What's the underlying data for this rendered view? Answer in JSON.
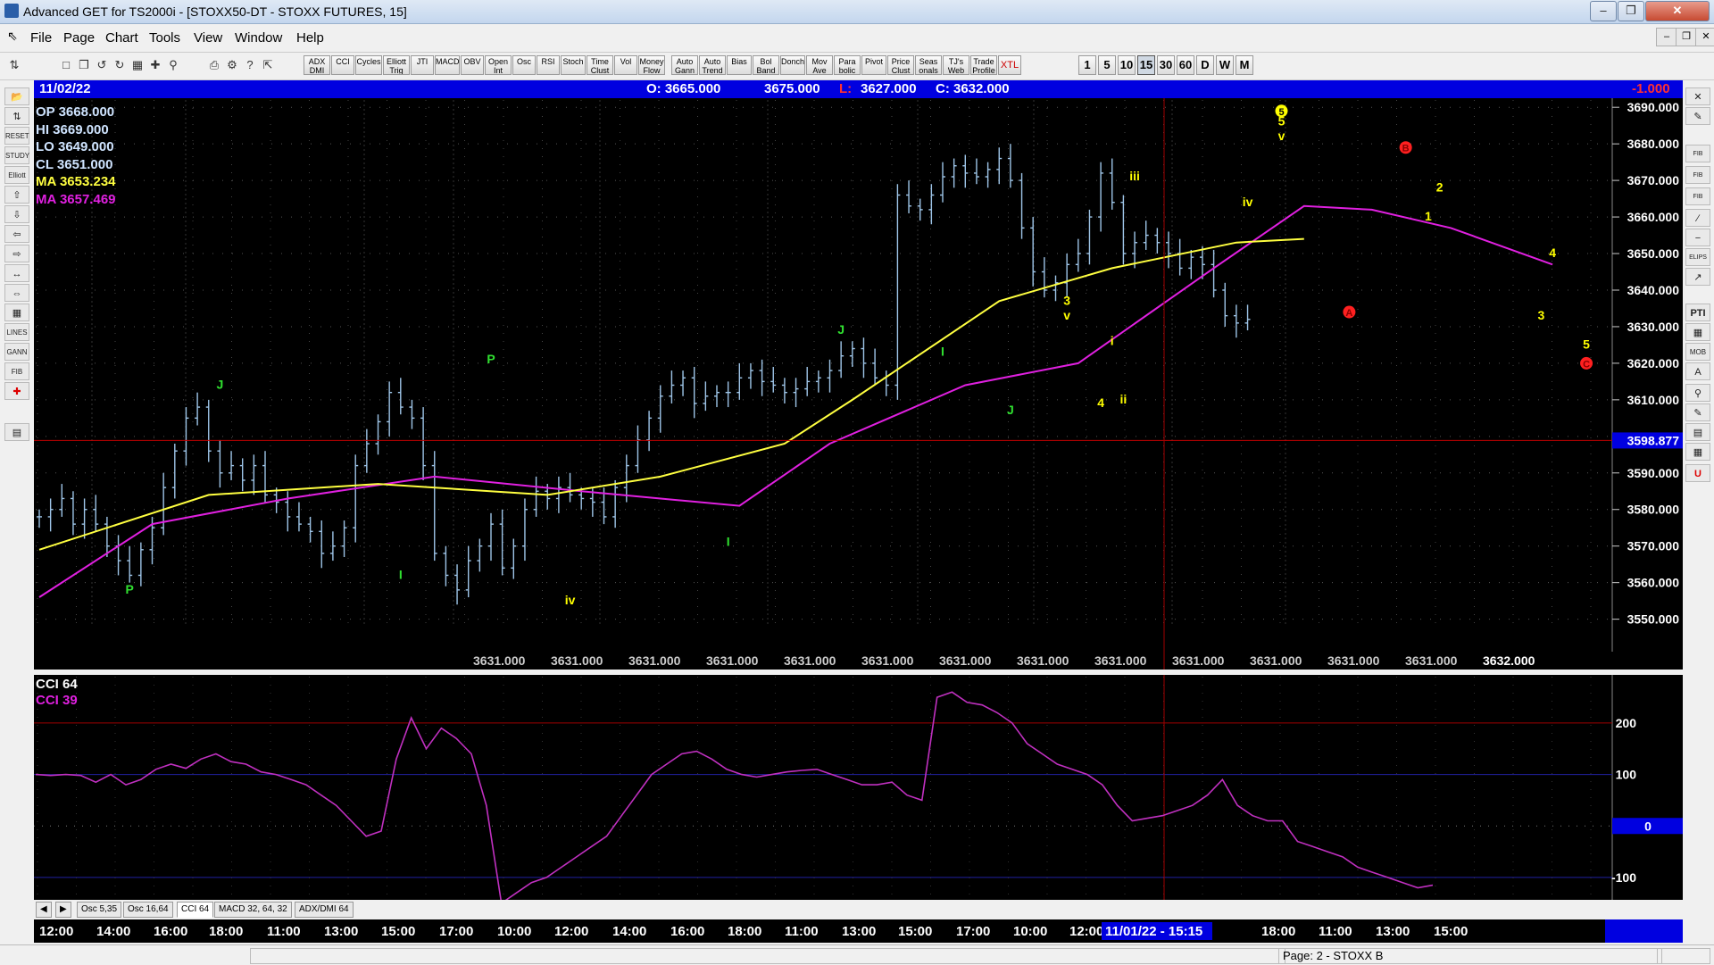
{
  "window": {
    "title": "Advanced GET for TS2000i - [STOXX50-DT - STOXX FUTURES, 15]"
  },
  "menu": [
    "File",
    "Page",
    "Chart",
    "Tools",
    "View",
    "Window",
    "Help"
  ],
  "toolbar": {
    "study_buttons": [
      "ADX DMI",
      "CCI",
      "Cycles",
      "Elliott Trig",
      "JTI",
      "MACD",
      "OBV",
      "Open Int",
      "Osc",
      "RSI",
      "Stoch",
      "Time Clust",
      "Vol",
      "Money Flow",
      "Auto Gann",
      "Auto Trend",
      "Bias",
      "Bol Band",
      "Donch",
      "Mov Ave",
      "Para bolic",
      "Pivot",
      "Price Clust",
      "Seas onals",
      "TJ's Web",
      "Trade Profile",
      "XTL"
    ],
    "timeframes": [
      "1",
      "5",
      "10",
      "15",
      "30",
      "60",
      "D",
      "W",
      "M"
    ],
    "active_timeframe": "15"
  },
  "info_bar": {
    "date": "11/02/22",
    "open": "O: 3665.000",
    "high": "3675.000",
    "low_label": "L:",
    "low": "3627.000",
    "close": "C: 3632.000",
    "change": "-1.000"
  },
  "legend": {
    "op": "OP 3668.000",
    "hi": "HI  3669.000",
    "lo": "LO  3649.000",
    "cl": "CL  3651.000",
    "ma1": "MA  3653.234",
    "ma2": "MA  3657.469"
  },
  "colors": {
    "bars": "#9ec5e8",
    "ma_yellow": "#ffff40",
    "ma_magenta": "#e020e0",
    "cci": "#c030c0",
    "wave_green": "#30e030",
    "wave_yellow": "#ffff00",
    "red": "#e00000",
    "info_bg": "#0000e0"
  },
  "chart_data": {
    "type": "candlestick",
    "y_ticks": [
      "3690.000",
      "3680.000",
      "3670.000",
      "3660.000",
      "3650.000",
      "3640.000",
      "3630.000",
      "3620.000",
      "3610.000",
      "3600.000",
      "3590.000",
      "3580.000",
      "3570.000",
      "3560.000",
      "3550.000"
    ],
    "ylim": [
      3546,
      3692
    ],
    "cursor_price": "3598.877",
    "bottom_values": [
      "3631.000",
      "3631.000",
      "3631.000",
      "3631.000",
      "3631.000",
      "3631.000",
      "3631.000",
      "3631.000",
      "3631.000",
      "3631.000",
      "3631.000",
      "3631.000",
      "3631.000",
      "3632.000"
    ],
    "closes": [
      3578,
      3580,
      3583,
      3576,
      3580,
      3576,
      3570,
      3566,
      3562,
      3569,
      3575,
      3586,
      3596,
      3605,
      3608,
      3596,
      3590,
      3592,
      3588,
      3592,
      3584,
      3582,
      3578,
      3576,
      3574,
      3568,
      3570,
      3575,
      3592,
      3598,
      3604,
      3612,
      3608,
      3605,
      3592,
      3568,
      3562,
      3558,
      3566,
      3570,
      3576,
      3564,
      3570,
      3580,
      3585,
      3583,
      3586,
      3584,
      3583,
      3582,
      3578,
      3586,
      3592,
      3599,
      3605,
      3611,
      3614,
      3616,
      3609,
      3611,
      3612,
      3612,
      3616,
      3618,
      3615,
      3614,
      3612,
      3613,
      3615,
      3616,
      3618,
      3622,
      3624,
      3620,
      3616,
      3614,
      3666,
      3663,
      3662,
      3666,
      3671,
      3674,
      3672,
      3671,
      3673,
      3676,
      3670,
      3657,
      3645,
      3640,
      3642,
      3647,
      3650,
      3660,
      3672,
      3664,
      3650,
      3653,
      3655,
      3653,
      3650,
      3646,
      3649,
      3647,
      3640,
      3633,
      3631,
      3632
    ],
    "ma_yellow_points": [
      [
        0,
        3569
      ],
      [
        15,
        3584
      ],
      [
        30,
        3587
      ],
      [
        45,
        3584
      ],
      [
        55,
        3589
      ],
      [
        66,
        3598
      ],
      [
        72,
        3610
      ],
      [
        85,
        3637
      ],
      [
        95,
        3646
      ],
      [
        106,
        3653
      ],
      [
        112,
        3654
      ]
    ],
    "ma_magenta_points": [
      [
        0,
        3556
      ],
      [
        10,
        3576
      ],
      [
        22,
        3583
      ],
      [
        35,
        3589
      ],
      [
        48,
        3585
      ],
      [
        62,
        3581
      ],
      [
        70,
        3598
      ],
      [
        82,
        3614
      ],
      [
        92,
        3620
      ],
      [
        104,
        3646
      ],
      [
        112,
        3663
      ],
      [
        118,
        3662
      ],
      [
        125,
        3657
      ],
      [
        134,
        3647
      ]
    ],
    "wave_labels": [
      {
        "text": "P",
        "bar": 8,
        "price": 3557,
        "color": "green"
      },
      {
        "text": "J",
        "bar": 16,
        "price": 3613,
        "color": "green"
      },
      {
        "text": "I",
        "bar": 32,
        "price": 3561,
        "color": "green"
      },
      {
        "text": "P",
        "bar": 40,
        "price": 3620,
        "color": "green"
      },
      {
        "text": "iv",
        "bar": 47,
        "price": 3554,
        "color": "yellow"
      },
      {
        "text": "I",
        "bar": 61,
        "price": 3570,
        "color": "green"
      },
      {
        "text": "J",
        "bar": 71,
        "price": 3628,
        "color": "green"
      },
      {
        "text": "I",
        "bar": 80,
        "price": 3622,
        "color": "green"
      },
      {
        "text": "J",
        "bar": 86,
        "price": 3606,
        "color": "green"
      },
      {
        "text": "3",
        "bar": 91,
        "price": 3636,
        "color": "yellow"
      },
      {
        "text": "v",
        "bar": 91,
        "price": 3632,
        "color": "yellow"
      },
      {
        "text": "4",
        "bar": 94,
        "price": 3608,
        "color": "yellow"
      },
      {
        "text": "i",
        "bar": 95,
        "price": 3625,
        "color": "yellow"
      },
      {
        "text": "ii",
        "bar": 96,
        "price": 3609,
        "color": "yellow"
      },
      {
        "text": "iii",
        "bar": 97,
        "price": 3670,
        "color": "yellow"
      },
      {
        "text": "iv",
        "bar": 107,
        "price": 3663,
        "color": "yellow"
      },
      {
        "text": "5",
        "bar": 110,
        "price": 3685,
        "color": "yellow"
      },
      {
        "text": "v",
        "bar": 110,
        "price": 3681,
        "color": "yellow"
      },
      {
        "text": "1",
        "bar": 123,
        "price": 3659,
        "color": "yellow"
      },
      {
        "text": "2",
        "bar": 124,
        "price": 3667,
        "color": "yellow"
      },
      {
        "text": "4",
        "bar": 134,
        "price": 3649,
        "color": "yellow"
      },
      {
        "text": "3",
        "bar": 133,
        "price": 3632,
        "color": "yellow"
      },
      {
        "text": "5",
        "bar": 137,
        "price": 3624,
        "color": "yellow"
      }
    ],
    "circle_labels": [
      {
        "text": "5",
        "bar": 110,
        "price": 3689,
        "color": "yellow"
      },
      {
        "text": "A",
        "bar": 116,
        "price": 3634,
        "color": "red"
      },
      {
        "text": "B",
        "bar": 121,
        "price": 3679,
        "color": "red"
      },
      {
        "text": "C",
        "bar": 137,
        "price": 3620,
        "color": "red"
      }
    ]
  },
  "cci_pane": {
    "title": "CCI 64",
    "subtitle": "CCI  39",
    "y_ticks": [
      "200",
      "100",
      "0",
      "-100"
    ],
    "values": [
      100,
      98,
      100,
      98,
      85,
      100,
      80,
      90,
      110,
      120,
      112,
      130,
      140,
      125,
      120,
      105,
      100,
      90,
      80,
      60,
      40,
      10,
      -20,
      -10,
      130,
      210,
      150,
      190,
      170,
      140,
      40,
      -150,
      -130,
      -110,
      -100,
      -80,
      -60,
      -40,
      -20,
      20,
      60,
      100,
      120,
      140,
      145,
      130,
      110,
      100,
      95,
      100,
      105,
      108,
      110,
      100,
      90,
      80,
      80,
      85,
      60,
      50,
      250,
      260,
      240,
      235,
      220,
      200,
      160,
      140,
      120,
      110,
      100,
      80,
      40,
      10,
      15,
      20,
      30,
      40,
      60,
      90,
      40,
      20,
      10,
      10,
      -30,
      -40,
      -50,
      -60,
      -80,
      -90,
      -100,
      -110,
      -120,
      -115
    ]
  },
  "tabs": [
    "Osc 5,35",
    "Osc 16,64",
    "CCI 64",
    "MACD 32, 64, 32",
    "ADX/DMI 64"
  ],
  "active_tab": "CCI 64",
  "time_axis": [
    "12:00",
    "14:00",
    "16:00",
    "18:00",
    "11:00",
    "13:00",
    "15:00",
    "17:00",
    "10:00",
    "12:00",
    "14:00",
    "16:00",
    "18:00",
    "11:00",
    "13:00",
    "15:00",
    "17:00",
    "10:00",
    "12:00",
    "18:00",
    "11:00",
    "13:00",
    "15:00"
  ],
  "cursor_time": "11/01/22 - 15:15",
  "status": "Page: 2 - STOXX B"
}
